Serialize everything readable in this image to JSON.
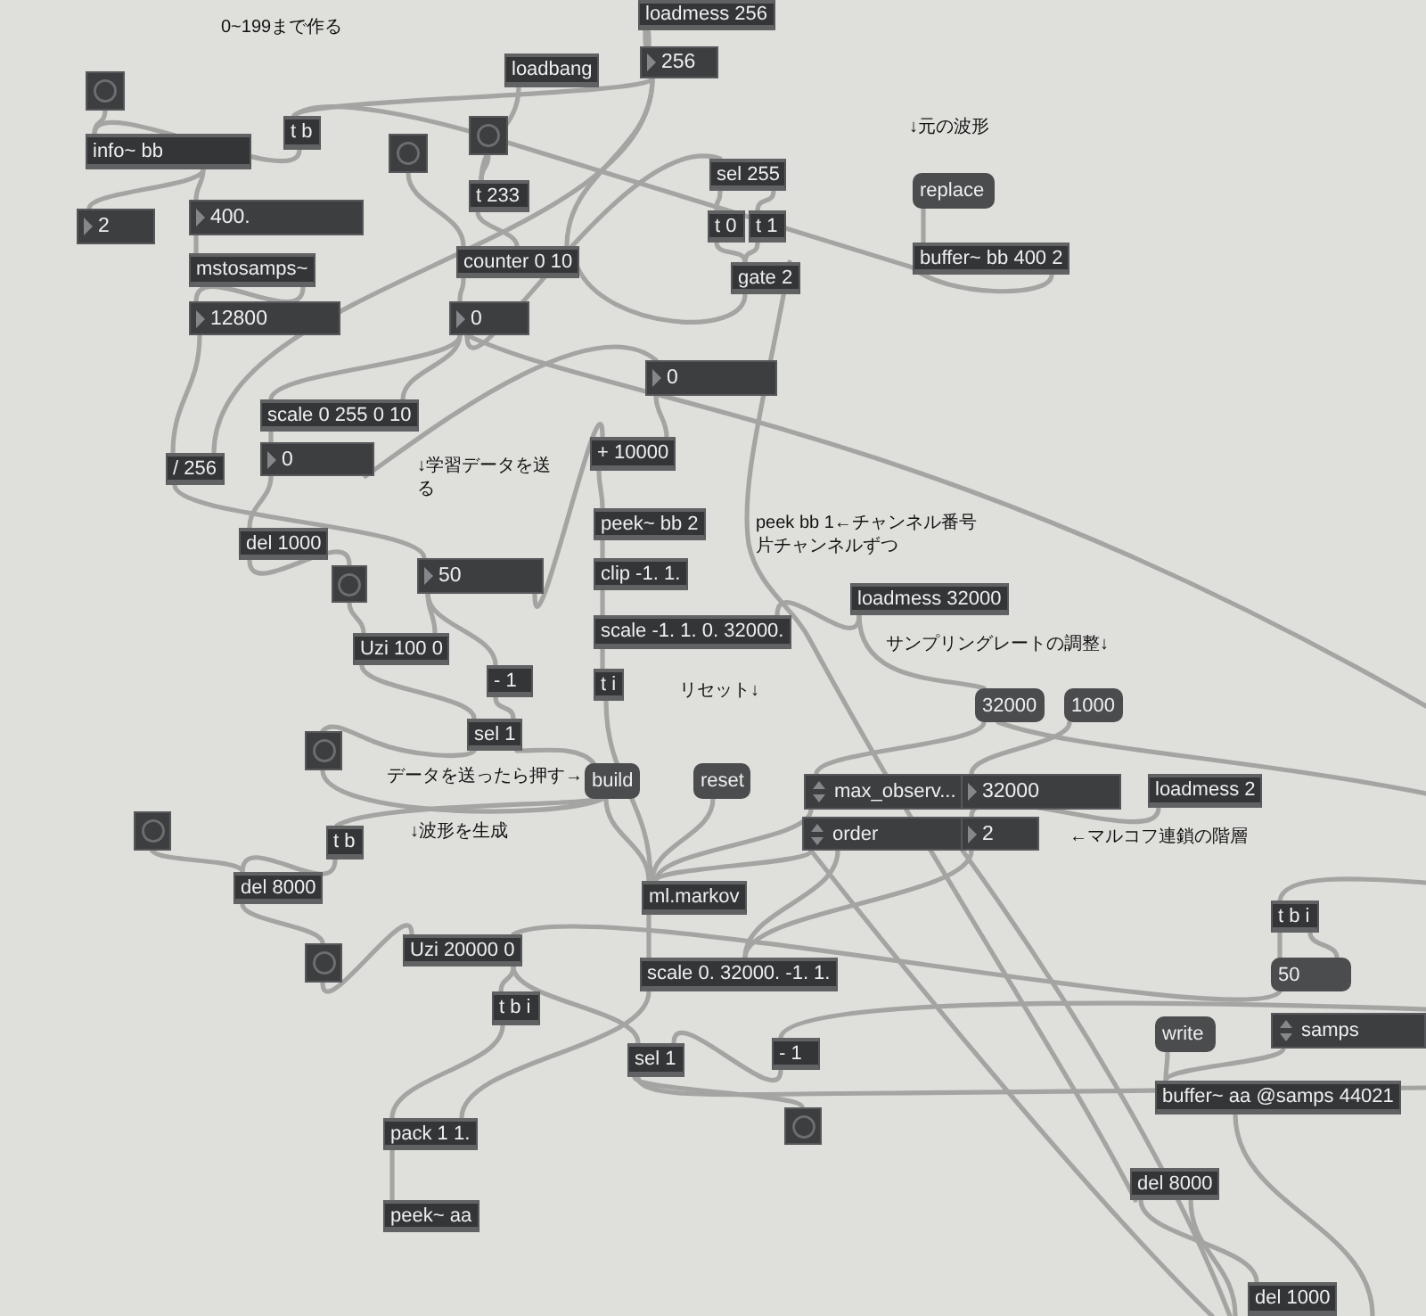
{
  "patcher": {
    "boxes": [
      {
        "kind": "comment",
        "text": "0~199まで作る"
      },
      {
        "kind": "object",
        "text": "loadmess 256"
      },
      {
        "kind": "object",
        "text": "loadbang"
      },
      {
        "kind": "number",
        "text": "256"
      },
      {
        "kind": "button"
      },
      {
        "kind": "object",
        "text": "info~ bb"
      },
      {
        "kind": "object",
        "text": "t b"
      },
      {
        "kind": "button"
      },
      {
        "kind": "button"
      },
      {
        "kind": "comment",
        "text": "↓元の波形"
      },
      {
        "kind": "number",
        "text": "2"
      },
      {
        "kind": "number",
        "text": "400."
      },
      {
        "kind": "object",
        "text": "t 233"
      },
      {
        "kind": "object",
        "text": "sel 255"
      },
      {
        "kind": "object",
        "text": "t 0"
      },
      {
        "kind": "object",
        "text": "t 1"
      },
      {
        "kind": "message",
        "text": "replace"
      },
      {
        "kind": "object",
        "text": "mstosamps~"
      },
      {
        "kind": "object",
        "text": "counter 0 10"
      },
      {
        "kind": "object",
        "text": "gate 2"
      },
      {
        "kind": "object",
        "text": "buffer~ bb 400 2"
      },
      {
        "kind": "number",
        "text": "12800"
      },
      {
        "kind": "number",
        "text": "0"
      },
      {
        "kind": "number",
        "text": "0"
      },
      {
        "kind": "object",
        "text": "scale 0 255 0 10"
      },
      {
        "kind": "object",
        "text": "/ 256"
      },
      {
        "kind": "number",
        "text": "0"
      },
      {
        "kind": "comment",
        "text": "↓学習データを送る"
      },
      {
        "kind": "object",
        "text": "+ 10000"
      },
      {
        "kind": "object",
        "text": "del 1000"
      },
      {
        "kind": "object",
        "text": "peek~ bb 2"
      },
      {
        "kind": "comment",
        "text": "peek bb 1←チャンネル番号片チャンネルずつ"
      },
      {
        "kind": "button"
      },
      {
        "kind": "number",
        "text": "50"
      },
      {
        "kind": "object",
        "text": "clip -1. 1."
      },
      {
        "kind": "object",
        "text": "loadmess 32000"
      },
      {
        "kind": "object",
        "text": "Uzi 100 0"
      },
      {
        "kind": "object",
        "text": "scale -1. 1. 0. 32000."
      },
      {
        "kind": "comment",
        "text": "サンプリングレートの調整↓"
      },
      {
        "kind": "object",
        "text": "- 1"
      },
      {
        "kind": "object",
        "text": "t i"
      },
      {
        "kind": "comment",
        "text": "リセット↓"
      },
      {
        "kind": "message",
        "text": "32000"
      },
      {
        "kind": "message",
        "text": "1000"
      },
      {
        "kind": "button"
      },
      {
        "kind": "object",
        "text": "sel 1"
      },
      {
        "kind": "comment",
        "text": "データを送ったら押す→"
      },
      {
        "kind": "message",
        "text": "build"
      },
      {
        "kind": "message",
        "text": "reset"
      },
      {
        "kind": "menu",
        "text": "max_observ..."
      },
      {
        "kind": "number",
        "text": "32000"
      },
      {
        "kind": "object",
        "text": "loadmess 2"
      },
      {
        "kind": "button"
      },
      {
        "kind": "object",
        "text": "t b"
      },
      {
        "kind": "comment",
        "text": "↓波形を生成"
      },
      {
        "kind": "menu",
        "text": "order"
      },
      {
        "kind": "number",
        "text": "2"
      },
      {
        "kind": "comment",
        "text": "←マルコフ連鎖の階層"
      },
      {
        "kind": "object",
        "text": "del 8000"
      },
      {
        "kind": "object",
        "text": "ml.markov"
      },
      {
        "kind": "object",
        "text": "t b i"
      },
      {
        "kind": "button"
      },
      {
        "kind": "object",
        "text": "Uzi 20000 0"
      },
      {
        "kind": "object",
        "text": "scale 0. 32000. -1. 1."
      },
      {
        "kind": "message",
        "text": "50"
      },
      {
        "kind": "object",
        "text": "t b i"
      },
      {
        "kind": "object",
        "text": "sel 1"
      },
      {
        "kind": "object",
        "text": "- 1"
      },
      {
        "kind": "message",
        "text": "write"
      },
      {
        "kind": "menu",
        "text": "samps"
      },
      {
        "kind": "object",
        "text": "pack 1 1."
      },
      {
        "kind": "button"
      },
      {
        "kind": "object",
        "text": "buffer~ aa @samps 44021"
      },
      {
        "kind": "object",
        "text": "del 8000"
      },
      {
        "kind": "object",
        "text": "peek~ aa"
      },
      {
        "kind": "object",
        "text": "del 1000"
      }
    ]
  }
}
